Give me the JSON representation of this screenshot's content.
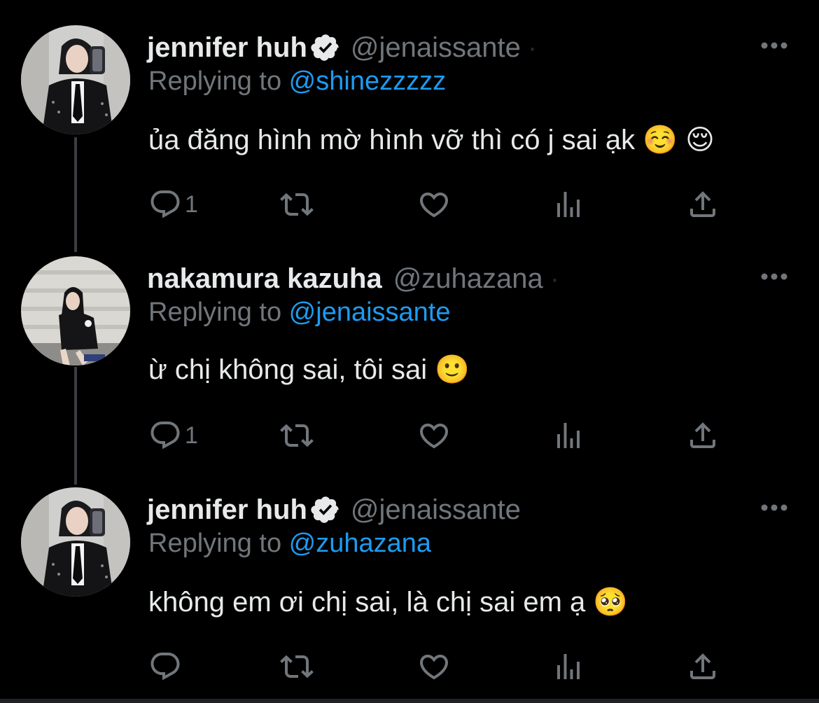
{
  "tweets": [
    {
      "display_name": "jennifer huh",
      "verified": true,
      "handle": "@jenaissante",
      "trailing": "·",
      "replying_prefix": "Replying to ",
      "replying_to": "@shinezzzzz",
      "text": "ủa đăng hình mờ hình vỡ thì có j sai ạk ☺️ 😌",
      "reply_count": "1",
      "avatar": "jennifer-avatar"
    },
    {
      "display_name": "nakamura kazuha",
      "verified": false,
      "handle": "@zuhazana",
      "trailing": "·",
      "replying_prefix": "Replying to ",
      "replying_to": "@jenaissante",
      "text": "ừ chị không sai, tôi sai 🙂",
      "reply_count": "1",
      "avatar": "kazuha-avatar"
    },
    {
      "display_name": "jennifer huh",
      "verified": true,
      "handle": "@jenaissante",
      "trailing": "",
      "replying_prefix": "Replying to ",
      "replying_to": "@zuhazana",
      "text": "không em ơi chị sai, là chị sai em ạ 🥺",
      "reply_count": "",
      "avatar": "jennifer-avatar"
    }
  ],
  "icons": {
    "reply": "reply-icon",
    "retweet": "retweet-icon",
    "like": "heart-icon",
    "views": "views-icon",
    "share": "share-icon",
    "more": "more-icon",
    "verified": "verified-badge-icon"
  },
  "colors": {
    "background": "#000000",
    "text": "#e7e9ea",
    "muted": "#71767b",
    "link": "#1d9bf0",
    "thread_line": "#3a3d41"
  }
}
